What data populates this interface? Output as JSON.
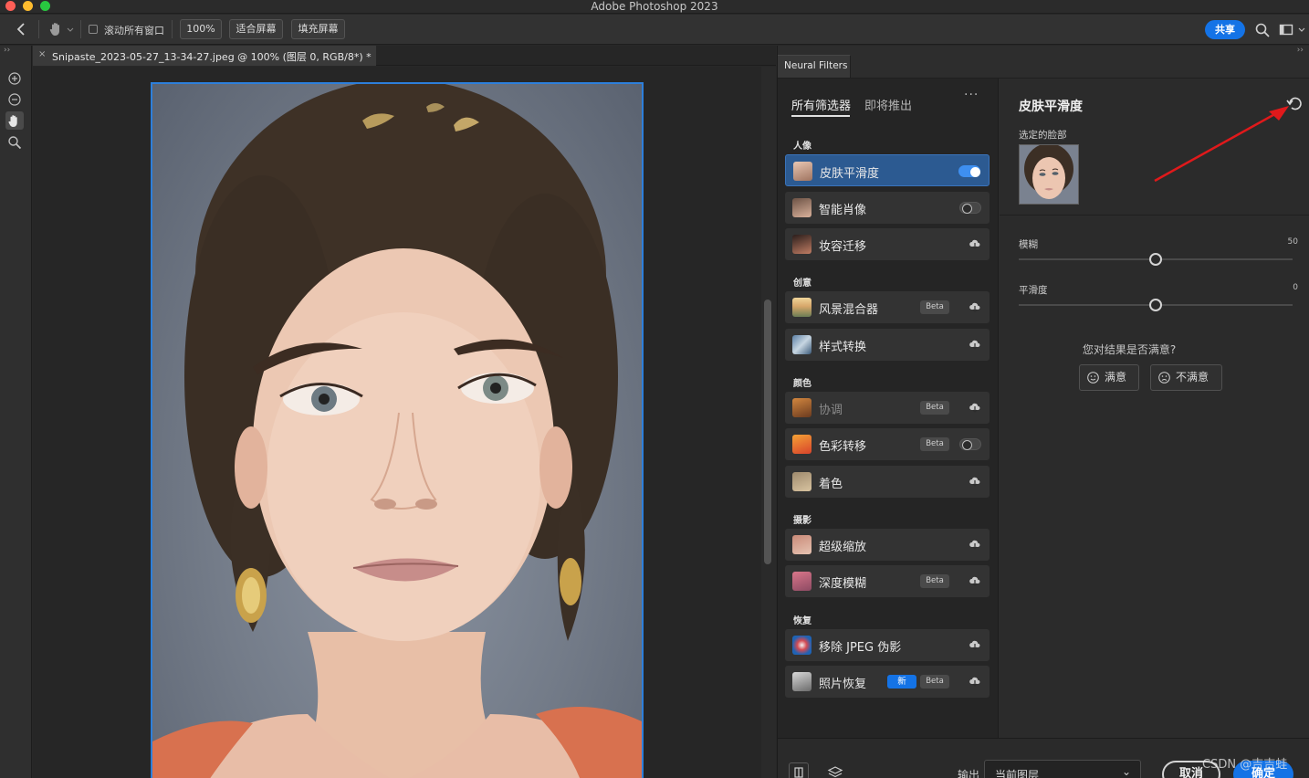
{
  "window": {
    "title": "Adobe Photoshop 2023"
  },
  "options_bar": {
    "scroll_all_windows_label": "滚动所有窗口",
    "zoom_label": "100%",
    "fit_screen_label": "适合屏幕",
    "fill_screen_label": "填充屏幕",
    "share_label": "共享"
  },
  "document": {
    "tab_title": "Snipaste_2023-05-27_13-34-27.jpeg @ 100% (图层 0, RGB/8*) *",
    "close_label": "×"
  },
  "neural_filters": {
    "panel_title": "Neural Filters",
    "subtabs": [
      "所有筛选器",
      "即将推出"
    ],
    "more_label": "···",
    "categories": [
      {
        "label": "人像",
        "items": [
          {
            "name": "皮肤平滑度",
            "control": "toggle-on",
            "selected": true
          },
          {
            "name": "智能肖像",
            "control": "toggle-off"
          },
          {
            "name": "妆容迁移",
            "control": "cloud"
          }
        ]
      },
      {
        "label": "创意",
        "items": [
          {
            "name": "风景混合器",
            "badge": "Beta",
            "control": "cloud"
          },
          {
            "name": "样式转换",
            "control": "cloud"
          }
        ]
      },
      {
        "label": "颜色",
        "items": [
          {
            "name": "协调",
            "badge": "Beta",
            "control": "cloud",
            "dimmed": true
          },
          {
            "name": "色彩转移",
            "badge": "Beta",
            "control": "toggle-off"
          },
          {
            "name": "着色",
            "control": "cloud"
          }
        ]
      },
      {
        "label": "摄影",
        "items": [
          {
            "name": "超级缩放",
            "control": "cloud"
          },
          {
            "name": "深度模糊",
            "badge": "Beta",
            "control": "cloud"
          }
        ]
      },
      {
        "label": "恢复",
        "items": [
          {
            "name": "移除 JPEG 伪影",
            "control": "cloud"
          },
          {
            "name": "照片恢复",
            "new_badge": "新",
            "badge": "Beta",
            "control": "cloud"
          }
        ]
      }
    ],
    "detail": {
      "title": "皮肤平滑度",
      "selected_face_label": "选定的脸部",
      "sliders": [
        {
          "label": "模糊",
          "value": "50",
          "fraction": 0.5
        },
        {
          "label": "平滑度",
          "value": "0",
          "fraction": 0.5
        }
      ],
      "satisfaction_question": "您对结果是否满意?",
      "satisfied_label": "满意",
      "unsatisfied_label": "不满意"
    },
    "bottom": {
      "output_label": "输出",
      "output_value": "当前图层",
      "cancel_label": "取消",
      "ok_label": "确定"
    }
  },
  "watermark": "CSDN @吉吉蛙",
  "colors": {
    "accent": "#1473e6",
    "selection": "#2c5a91",
    "annotation_arrow": "#e0191b"
  }
}
